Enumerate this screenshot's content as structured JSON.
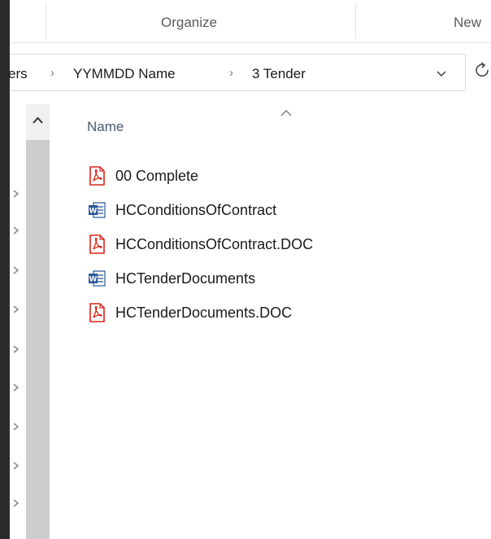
{
  "ribbon": {
    "groups": [
      "Organize",
      "New"
    ]
  },
  "address": {
    "crumbs": [
      "ers",
      "YYMMDD Name",
      "3 Tender"
    ]
  },
  "file_list": {
    "column_name": "Name",
    "files": [
      {
        "name": "00 Complete",
        "type": "pdf"
      },
      {
        "name": "HCConditionsOfContract",
        "type": "word"
      },
      {
        "name": "HCConditionsOfContract.DOC",
        "type": "pdf"
      },
      {
        "name": "HCTenderDocuments",
        "type": "word"
      },
      {
        "name": "HCTenderDocuments.DOC",
        "type": "pdf"
      }
    ]
  },
  "colors": {
    "pdf_red": "#d9261c",
    "word_blue": "#2b5797"
  },
  "icons": {
    "pdf": "pdf-file-icon",
    "word": "word-document-icon"
  }
}
